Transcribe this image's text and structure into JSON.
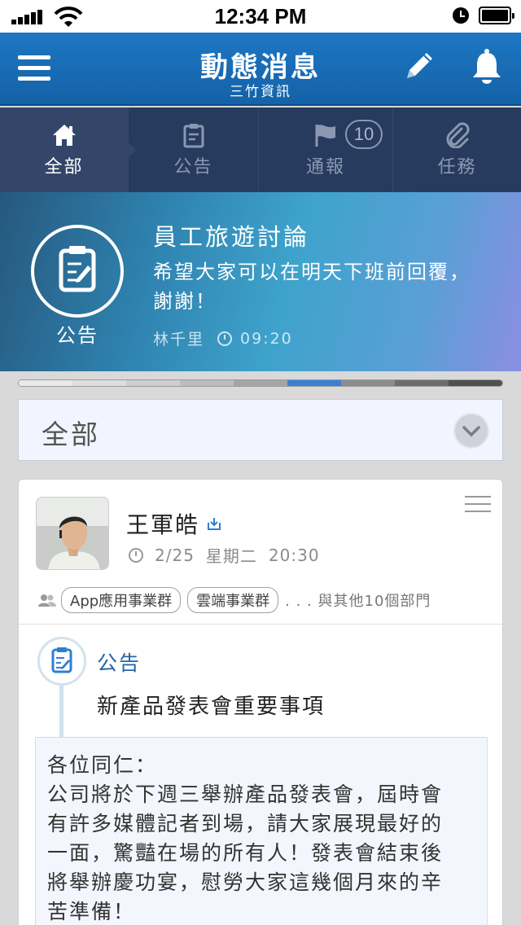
{
  "status_bar": {
    "time": "12:34 PM"
  },
  "header": {
    "title": "動態消息",
    "subtitle": "三竹資訊"
  },
  "tabs": [
    {
      "label": "全部",
      "icon": "home-icon",
      "active": true
    },
    {
      "label": "公告",
      "icon": "clipboard-icon",
      "active": false
    },
    {
      "label": "通報",
      "icon": "flag-icon",
      "active": false,
      "badge": "10"
    },
    {
      "label": "任務",
      "icon": "paperclip-icon",
      "active": false
    }
  ],
  "banner": {
    "type_label": "公告",
    "title": "員工旅遊討論",
    "body_line1": "希望大家可以在明天下班前回覆，",
    "body_line2": "謝謝！",
    "author": "林千里",
    "time": "09:20"
  },
  "progress_segments": [
    "#e9e9e9",
    "#dedede",
    "#cfcfcf",
    "#bdbdbd",
    "#a5a5a5",
    "#3a7fd6",
    "#8c8c8c",
    "#6d6d6d",
    "#4f4f4f"
  ],
  "filter": {
    "selected": "全部"
  },
  "post": {
    "author": "王軍皓",
    "date": "2/25",
    "weekday": "星期二",
    "time": "20:30",
    "departments": [
      "App應用事業群",
      "雲端事業群"
    ],
    "more_departments": ". . . 與其他10個部門",
    "type_label": "公告",
    "title": "新產品發表會重要事項",
    "body_lines": [
      "各位同仁：",
      "公司將於下週三舉辦產品發表會，屆時會",
      "有許多媒體記者到場，請大家展現最好的",
      "一面，驚豔在場的所有人！發表會結束後",
      "將舉辦慶功宴，慰勞大家這幾個月來的辛",
      "苦準備！"
    ]
  },
  "colors": {
    "nav_blue": "#1a6bb5",
    "tab_dark": "#273b5e",
    "accent_blue": "#2366a8"
  }
}
